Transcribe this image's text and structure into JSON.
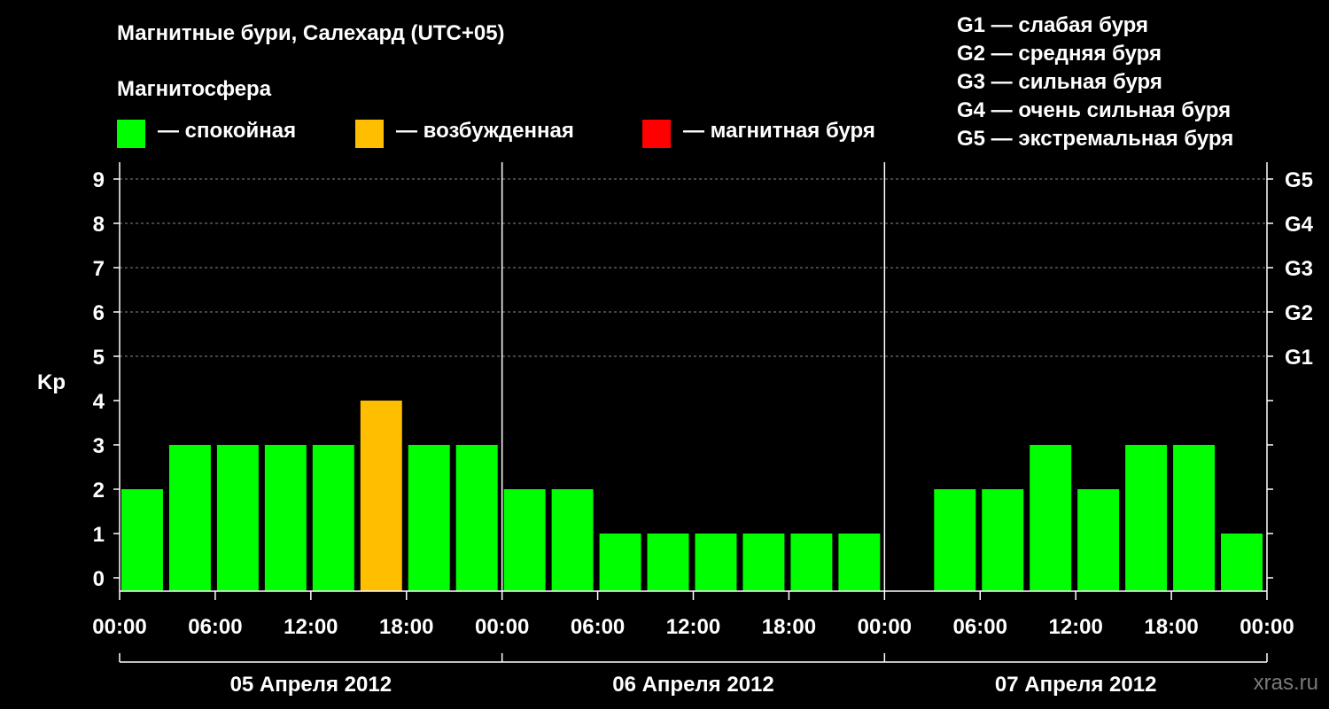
{
  "header": {
    "title": "Магнитные бури, Салехард (UTC+05)",
    "subtitle": "Магнитосфера"
  },
  "legend": {
    "states": [
      {
        "label": "— спокойная",
        "color": "#00ff00"
      },
      {
        "label": "— возбужденная",
        "color": "#ffbf00"
      },
      {
        "label": "— магнитная буря",
        "color": "#ff0000"
      }
    ],
    "g_scale": [
      "G1 — слабая буря",
      "G2 — средняя буря",
      "G3 — сильная буря",
      "G4 — очень сильная буря",
      "G5 — экстремальная буря"
    ]
  },
  "watermark": "xras.ru",
  "chart_data": {
    "type": "bar",
    "ylabel": "Kp",
    "ylim": [
      0,
      9
    ],
    "y_ticks": [
      "0",
      "1",
      "2",
      "3",
      "4",
      "5",
      "6",
      "7",
      "8",
      "9"
    ],
    "g_ticks": [
      {
        "level": 5,
        "label": "G1"
      },
      {
        "level": 6,
        "label": "G2"
      },
      {
        "level": 7,
        "label": "G3"
      },
      {
        "level": 8,
        "label": "G4"
      },
      {
        "level": 9,
        "label": "G5"
      }
    ],
    "grid": "dashed horizontal at Kp 5-9",
    "x_tick_labels": [
      "00:00",
      "06:00",
      "12:00",
      "18:00",
      "00:00",
      "06:00",
      "12:00",
      "18:00",
      "00:00",
      "06:00",
      "12:00",
      "18:00",
      "00:00"
    ],
    "days": [
      "05 Апреля 2012",
      "06 Апреля 2012",
      "07 Апреля 2012"
    ],
    "bar_hours": 3,
    "values": [
      2,
      3,
      3,
      3,
      3,
      4,
      3,
      3,
      2,
      2,
      1,
      1,
      1,
      1,
      1,
      1,
      null,
      2,
      2,
      3,
      2,
      3,
      3,
      1
    ],
    "colors": {
      "quiet": "#00ff00",
      "active": "#ffbf00",
      "storm": "#ff0000"
    }
  }
}
